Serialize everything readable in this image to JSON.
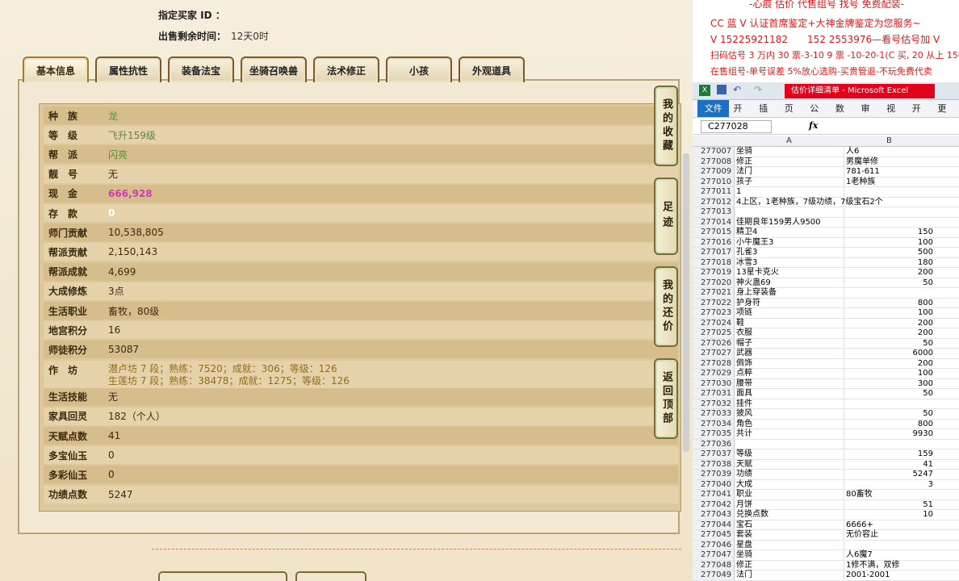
{
  "seller": {
    "label": "指定买家 ID ：",
    "time_label": "出售剩余时间：",
    "time_value": "12天0时"
  },
  "tabs": [
    {
      "label": "基本信息"
    },
    {
      "label": "属性抗性"
    },
    {
      "label": "装备法宝"
    },
    {
      "label": "坐骑召唤兽"
    },
    {
      "label": "法术修正"
    },
    {
      "label": "小孩"
    },
    {
      "label": "外观道具"
    }
  ],
  "rows": [
    {
      "k": "种　族",
      "v": "龙"
    },
    {
      "k": "等　级",
      "v": "飞升159级"
    },
    {
      "k": "帮　派",
      "v": "闪亮"
    },
    {
      "k": "靓　号",
      "v": "无"
    },
    {
      "k": "现　金",
      "v": "666,928"
    },
    {
      "k": "存　款",
      "v": "0"
    },
    {
      "k": "师门贡献",
      "v": "10,538,805"
    },
    {
      "k": "帮派贡献",
      "v": "2,150,143"
    },
    {
      "k": "帮派成就",
      "v": "4,699"
    },
    {
      "k": "大成修炼",
      "v": "3点"
    },
    {
      "k": "生活职业",
      "v": "畜牧，80级"
    },
    {
      "k": "地宫积分",
      "v": "16"
    },
    {
      "k": "师徒积分",
      "v": "53087"
    },
    {
      "k": "作　坊",
      "v": "潜卢坊 7 段；熟练：7520；成就：306；等级：126",
      "v2": "生莲坊 7 段；熟练：38478；成就：1275；等级：126"
    },
    {
      "k": "生活技能",
      "v": "无"
    },
    {
      "k": "家具回灵",
      "v": "182（个人）"
    },
    {
      "k": "天赋点数",
      "v": "41"
    },
    {
      "k": "多宝仙玉",
      "v": "0"
    },
    {
      "k": "多彩仙玉",
      "v": "0"
    },
    {
      "k": "功绩点数",
      "v": "5247"
    }
  ],
  "side_buttons": [
    {
      "label": "我的收藏"
    },
    {
      "label": "足迹"
    },
    {
      "label": "我的还价"
    },
    {
      "label": "返回顶部"
    }
  ],
  "ad": {
    "line0": "-心痕 估价 代售组号 找号 免费配装-",
    "line1": "CC 蓝 V 认证首席鉴定+大神金牌鉴定为您服务~",
    "line2": "V 15225921182　　152 2553976—看号估号加 V",
    "line3": "扫码估号 3 万内 30 票-3-10 9 票 -10-20-1(C 买, 20 从上 150",
    "line4": "在售组号-单号误差 5%放心选购-买贵管退-不玩免费代卖"
  },
  "excel": {
    "title": "估价详细清单 - Microsoft Excel",
    "ribbon": [
      "文件",
      "开始",
      "插入",
      "页面",
      "公式",
      "数据",
      "审阅",
      "视图",
      "开发",
      "更多"
    ],
    "namebox": "C277028",
    "fx": "fx",
    "col_a": "A",
    "col_b": "B",
    "rows": [
      {
        "n": "277007",
        "a": "坐骑",
        "b": "人6"
      },
      {
        "n": "277008",
        "a": "修正",
        "b": "男魔单修"
      },
      {
        "n": "277009",
        "a": "法门",
        "b": "781-611"
      },
      {
        "n": "277010",
        "a": "孩子",
        "b": "1老种族"
      },
      {
        "n": "277011",
        "a": "1",
        "b": ""
      },
      {
        "n": "277012",
        "a": "4上区，1老种族，7级功绩，7级宝石2个",
        "b": ""
      },
      {
        "n": "277013",
        "a": "",
        "b": ""
      },
      {
        "n": "277014",
        "a": "佳期良年159男人9500",
        "b": ""
      },
      {
        "n": "277015",
        "a": "精卫4",
        "b": "150"
      },
      {
        "n": "277016",
        "a": "小牛魔王3",
        "b": "100"
      },
      {
        "n": "277017",
        "a": "孔雀3",
        "b": "500"
      },
      {
        "n": "277018",
        "a": "冰雪3",
        "b": "180"
      },
      {
        "n": "277019",
        "a": "13星卡克火",
        "b": "200"
      },
      {
        "n": "277020",
        "a": "神火蛊69",
        "b": "50"
      },
      {
        "n": "277021",
        "a": "身上穿装备",
        "b": ""
      },
      {
        "n": "277022",
        "a": "护身符",
        "b": "800"
      },
      {
        "n": "277023",
        "a": "项链",
        "b": "100"
      },
      {
        "n": "277024",
        "a": "鞋",
        "b": "200"
      },
      {
        "n": "277025",
        "a": "衣服",
        "b": "200"
      },
      {
        "n": "277026",
        "a": "帽子",
        "b": "50"
      },
      {
        "n": "277027",
        "a": "武器",
        "b": "6000"
      },
      {
        "n": "277028",
        "a": "佩饰",
        "b": "200"
      },
      {
        "n": "277029",
        "a": "点粹",
        "b": "100"
      },
      {
        "n": "277030",
        "a": "腰带",
        "b": "300"
      },
      {
        "n": "277031",
        "a": "面具",
        "b": "50"
      },
      {
        "n": "277032",
        "a": "挂件",
        "b": ""
      },
      {
        "n": "277033",
        "a": "披风",
        "b": "50"
      },
      {
        "n": "277034",
        "a": "角色",
        "b": "800"
      },
      {
        "n": "277035",
        "a": "共计",
        "b": "9930"
      },
      {
        "n": "277036",
        "a": "",
        "b": ""
      },
      {
        "n": "277037",
        "a": "等级",
        "b": "159"
      },
      {
        "n": "277038",
        "a": "天赋",
        "b": "41"
      },
      {
        "n": "277039",
        "a": "功绩",
        "b": "5247"
      },
      {
        "n": "277040",
        "a": "大成",
        "b": "3"
      },
      {
        "n": "277041",
        "a": "职业",
        "b": "80畜牧"
      },
      {
        "n": "277042",
        "a": "月饼",
        "b": "51"
      },
      {
        "n": "277043",
        "a": "兑换点数",
        "b": "10"
      },
      {
        "n": "277044",
        "a": "宝石",
        "b": "6666+"
      },
      {
        "n": "277045",
        "a": "套装",
        "b": "无价容止"
      },
      {
        "n": "277046",
        "a": "星盘",
        "b": ""
      },
      {
        "n": "277047",
        "a": "坐骑",
        "b": "人6魔7"
      },
      {
        "n": "277048",
        "a": "修正",
        "b": "1修不满，双修"
      },
      {
        "n": "277049",
        "a": "法门",
        "b": "2001-2001"
      }
    ]
  }
}
